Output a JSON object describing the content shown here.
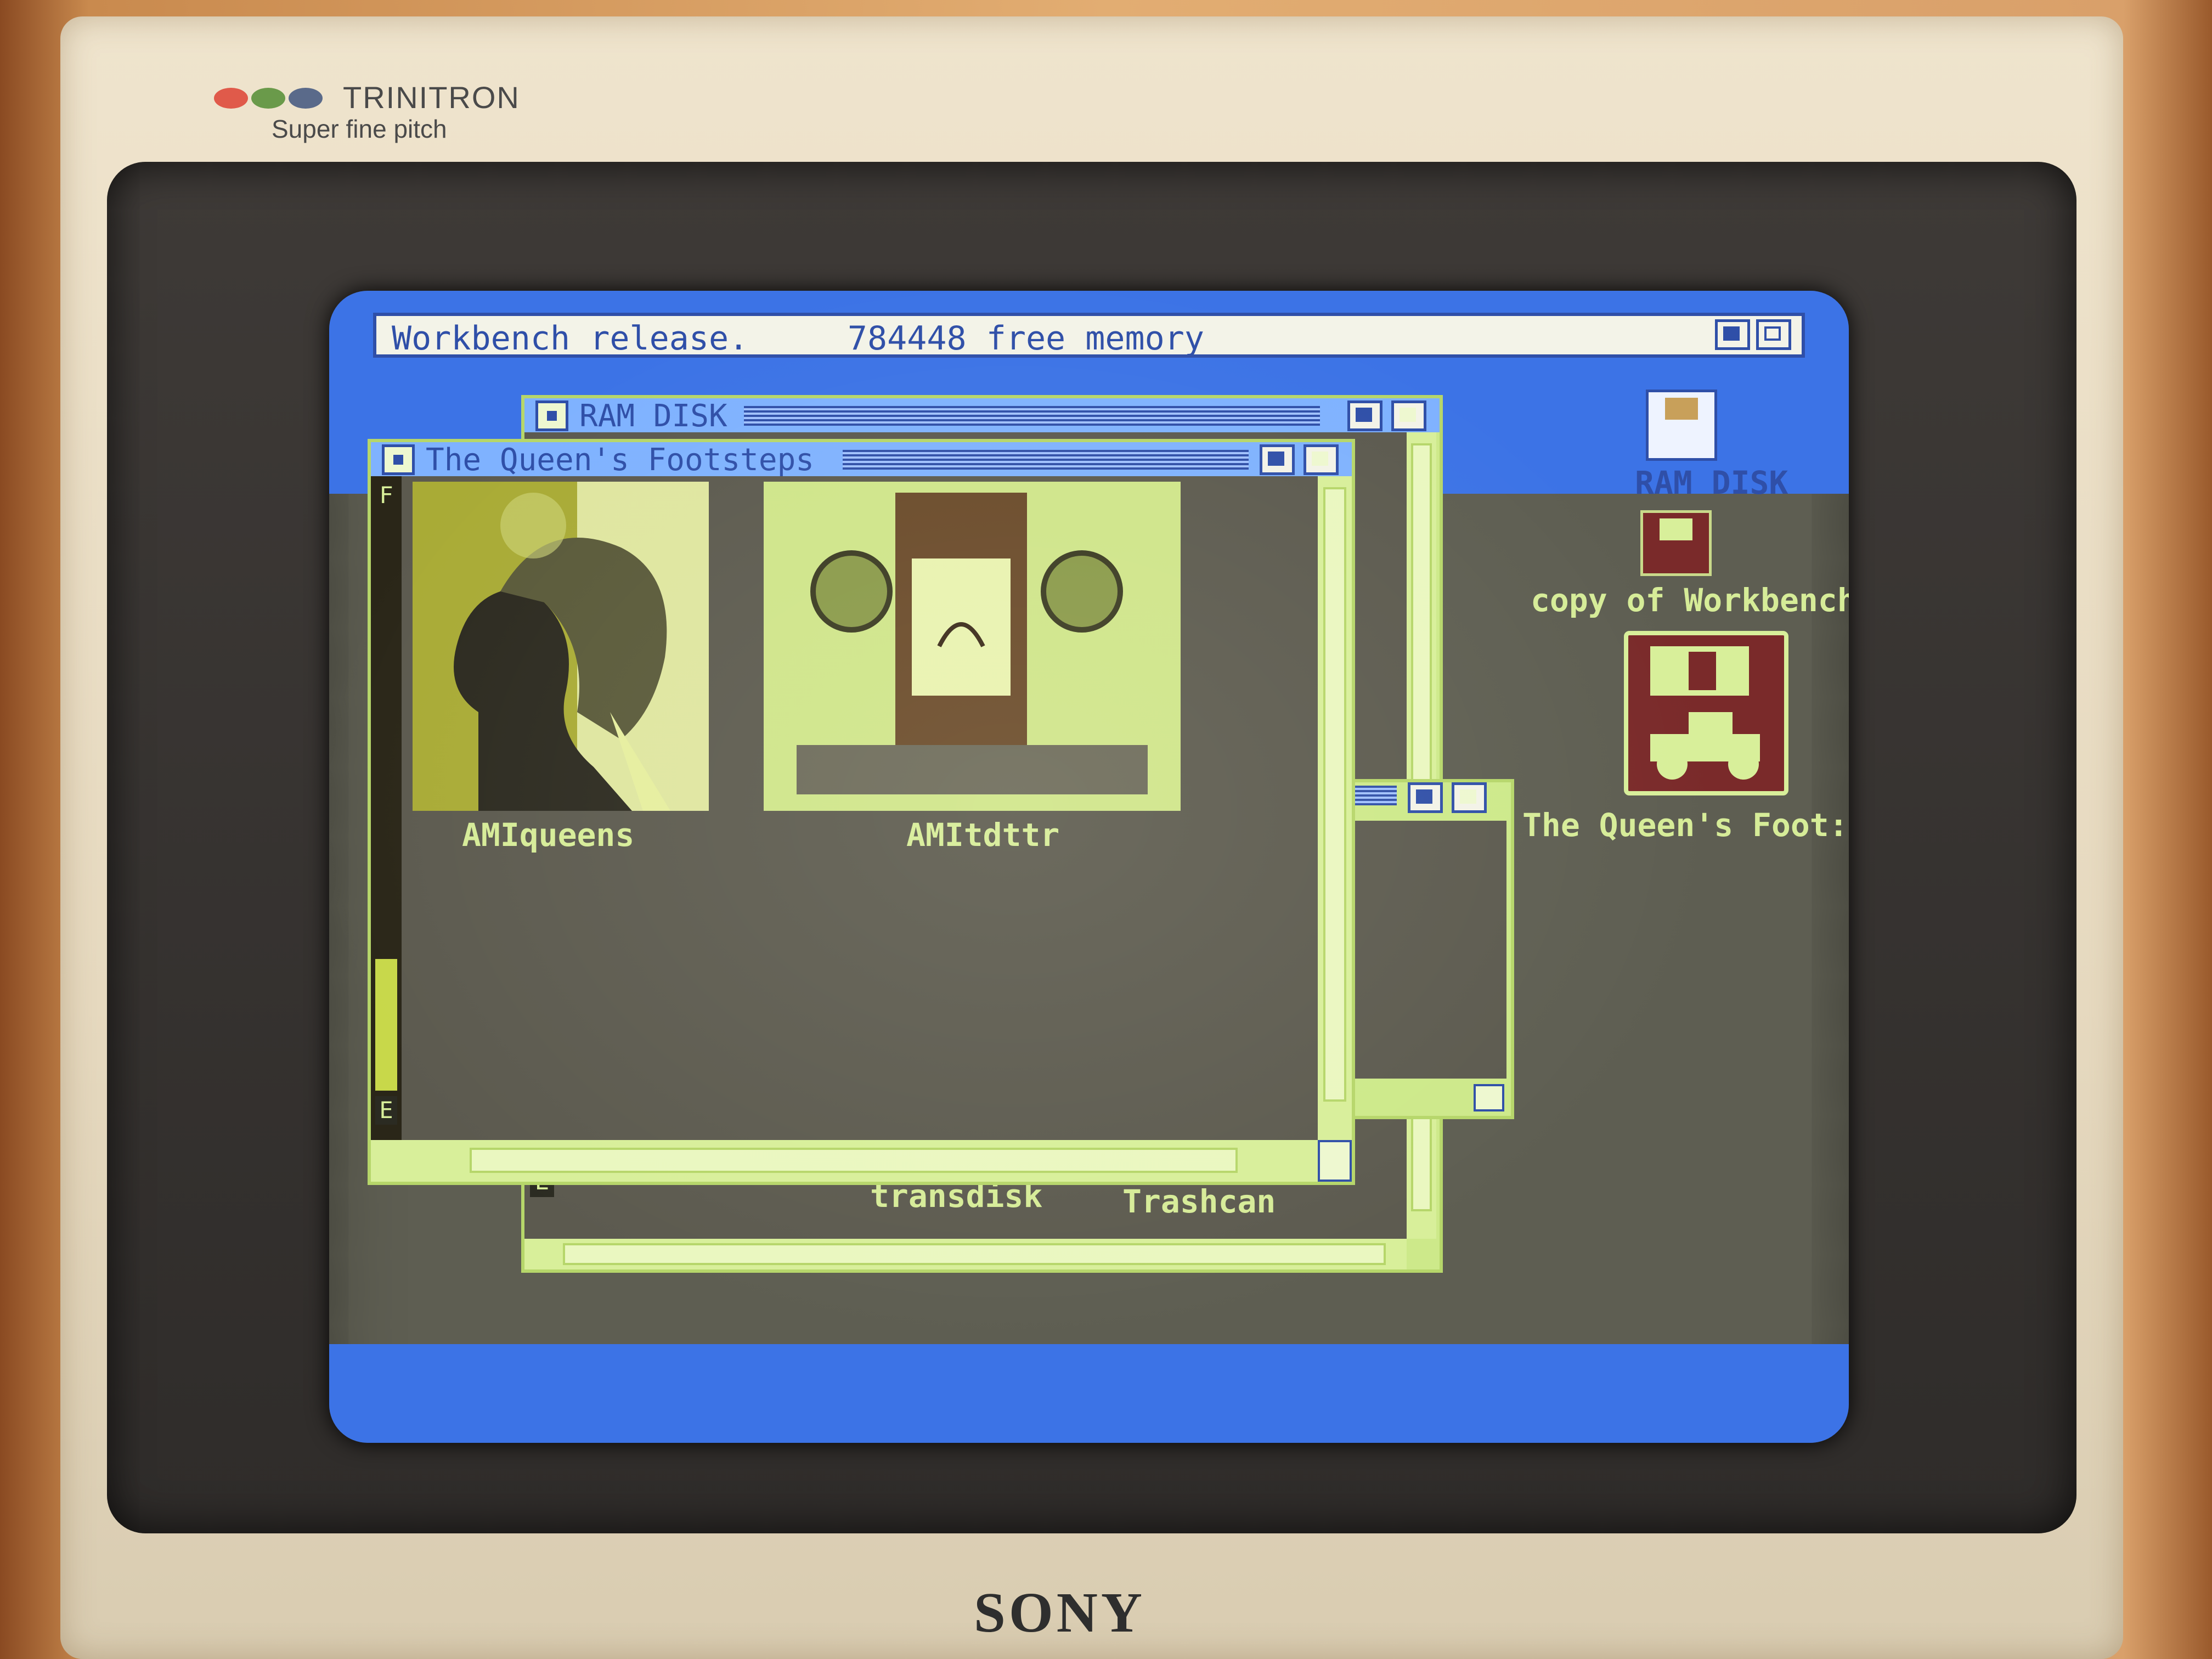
{
  "monitor": {
    "brand_line": "TRINITRON",
    "pitch_line": "Super fine pitch",
    "maker": "SONY",
    "lights": [
      "#e05a4a",
      "#6a9a4a",
      "#5a6a8a"
    ]
  },
  "workbench": {
    "title": "Workbench release.     784448 free memory",
    "accent": "#3c73e6"
  },
  "windows": {
    "ram_disk": {
      "title": "RAM DISK"
    },
    "queens": {
      "title": "The Queen's Footsteps"
    }
  },
  "icons": {
    "amiqueens": "AMIqueens",
    "amitdttr": "AMItdttr",
    "transdisk": "transdisk",
    "trashcan": "Trashcan",
    "ram_disk": "RAM DISK",
    "copy_of_workbench": "copy of Workbench",
    "queens_foot": "The Queen's Foot:"
  },
  "gadgets": {
    "e_label": "E",
    "f_label": "F"
  }
}
